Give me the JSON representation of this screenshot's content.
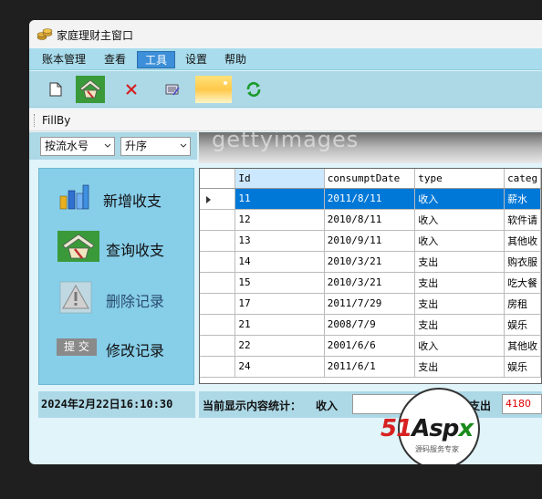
{
  "window": {
    "title": "家庭理财主窗口"
  },
  "menu": [
    {
      "label": "账本管理",
      "active": false
    },
    {
      "label": "查看",
      "active": false
    },
    {
      "label": "工具",
      "active": true
    },
    {
      "label": "设置",
      "active": false
    },
    {
      "label": "帮助",
      "active": false
    }
  ],
  "toolbar": {
    "buttons": [
      "new-document-icon",
      "query-icon",
      "delete-icon",
      "edit-icon",
      "gradient-icon",
      "refresh-icon"
    ]
  },
  "fillby": {
    "label": "FillBy"
  },
  "filters": {
    "sort_field": "按流水号",
    "sort_order": "升序"
  },
  "banner": {
    "watermark": "gettyimages"
  },
  "nav": [
    {
      "label": "新增收支",
      "icon": "chart-icon",
      "enabled": true
    },
    {
      "label": "查询收支",
      "icon": "query-icon",
      "enabled": true
    },
    {
      "label": "删除记录",
      "icon": "warning-icon",
      "enabled": false
    },
    {
      "label": "修改记录",
      "icon": "submit-badge-icon",
      "badge": "提 交",
      "enabled": true
    }
  ],
  "grid": {
    "columns": [
      "Id",
      "consumptDate",
      "type",
      "categ"
    ],
    "rows": [
      [
        "11",
        "2011/8/11",
        "收入",
        "薪水"
      ],
      [
        "12",
        "2010/8/11",
        "收入",
        "软件请"
      ],
      [
        "13",
        "2010/9/11",
        "收入",
        "其他收"
      ],
      [
        "14",
        "2010/3/21",
        "支出",
        "购衣服"
      ],
      [
        "15",
        "2010/3/21",
        "支出",
        "吃大餐"
      ],
      [
        "17",
        "2011/7/29",
        "支出",
        "房租"
      ],
      [
        "21",
        "2008/7/9",
        "支出",
        "娱乐"
      ],
      [
        "22",
        "2001/6/6",
        "收入",
        "其他收"
      ],
      [
        "24",
        "2011/6/1",
        "支出",
        "娱乐"
      ]
    ],
    "selected_row": 0
  },
  "status": {
    "datetime": "2024年2月22日16:10:30",
    "summary_label": "当前显示内容统计：",
    "income_label": "收入",
    "income_value": "",
    "expense_label": "支出",
    "expense_value": "4180"
  },
  "logo": {
    "text_red": "51",
    "text_dark": "Asp",
    "text_green": "x",
    "subtitle": "源码服务专家"
  },
  "colors": {
    "window_bg": "#e0f4fa",
    "menubar": "#a9dcec",
    "toolbar": "#add8e6",
    "menu_active": "#3c8fd8",
    "row_selected": "#0078d7",
    "nav_panel": "#87cee9"
  }
}
